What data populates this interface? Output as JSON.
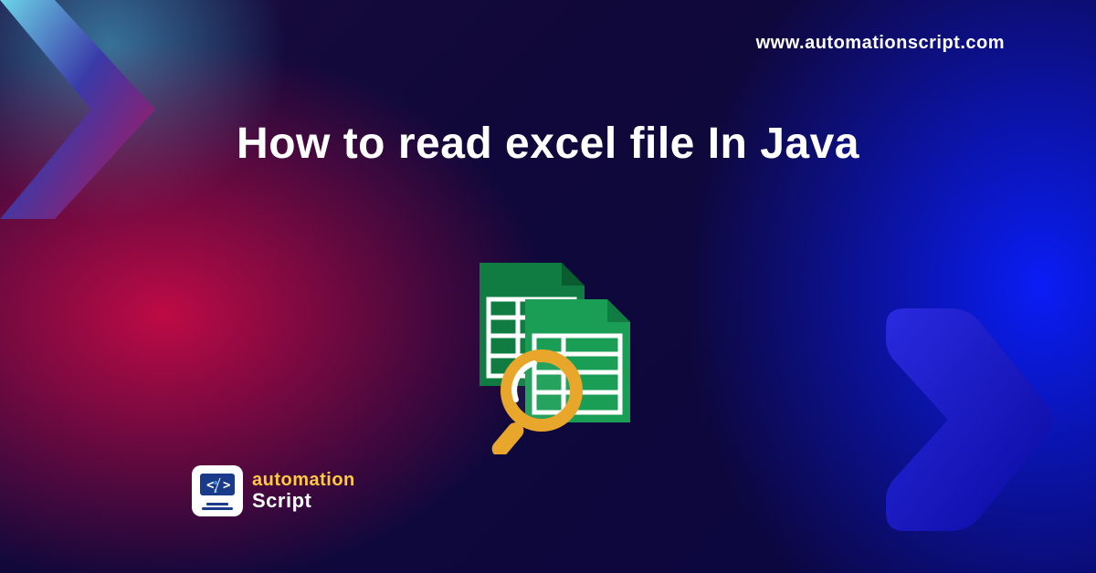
{
  "header": {
    "url": "www.automationscript.com"
  },
  "title": "How to read excel file In Java",
  "logo": {
    "line1": "automation",
    "line2": "Script"
  }
}
